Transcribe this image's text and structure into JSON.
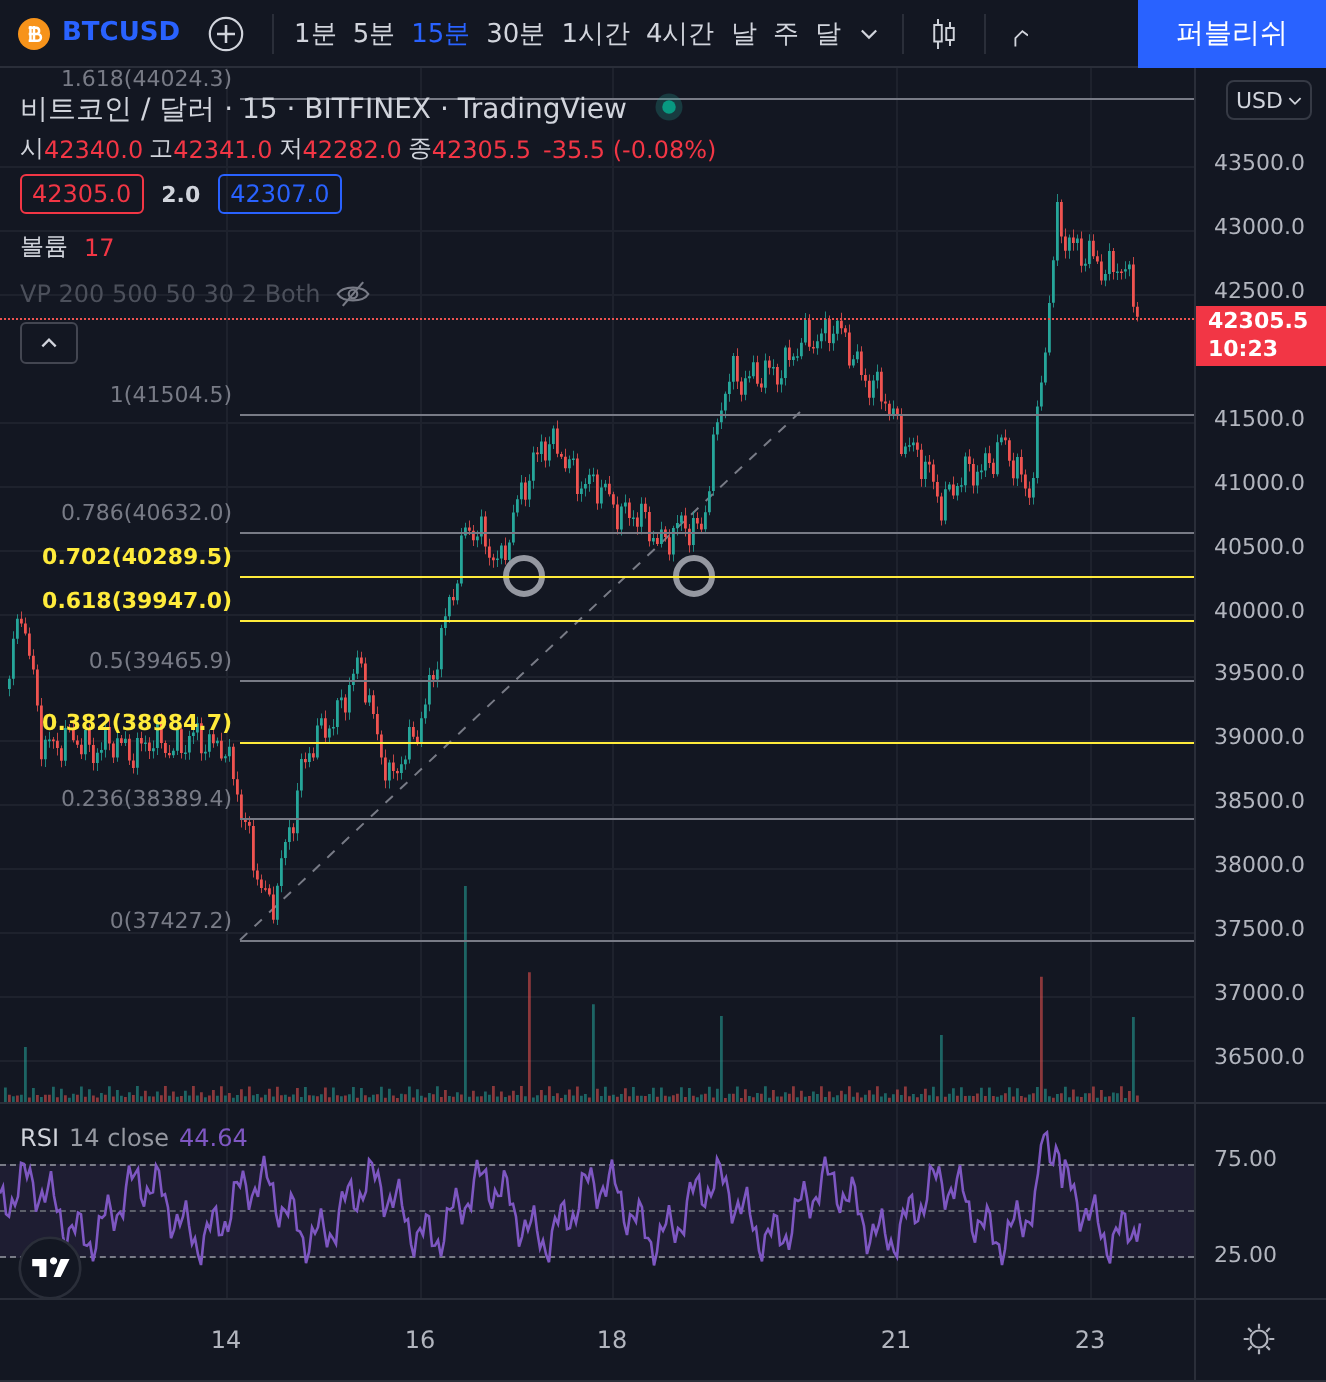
{
  "toolbar": {
    "symbol": "BTCUSD",
    "intervals": [
      {
        "label": "1분",
        "selected": false
      },
      {
        "label": "5분",
        "selected": false
      },
      {
        "label": "15분",
        "selected": true
      },
      {
        "label": "30분",
        "selected": false
      },
      {
        "label": "1시간",
        "selected": false
      },
      {
        "label": "4시간",
        "selected": false
      },
      {
        "label": "날",
        "selected": false
      },
      {
        "label": "주",
        "selected": false
      },
      {
        "label": "달",
        "selected": false
      }
    ],
    "publish_button": "퍼블리쉬"
  },
  "legend": {
    "title": "비트코인 / 달러 · 15 · BITFINEX · TradingView",
    "ohlc": [
      {
        "label": "시",
        "value": "42340.0"
      },
      {
        "label": "고",
        "value": "42341.0"
      },
      {
        "label": "저",
        "value": "42282.0"
      },
      {
        "label": "종",
        "value": "42305.5"
      }
    ],
    "change": "-35.5 (-0.08%)",
    "bid": "42305.0",
    "spread": "2.0",
    "ask": "42307.0",
    "volume": {
      "label": "볼륨",
      "value": "17"
    },
    "vp": "VP 200 500 50 30 2 Both"
  },
  "fib_levels": [
    {
      "label": "1.618(44024.3)",
      "color": "#787b86"
    },
    {
      "label": "1(41504.5)",
      "color": "#787b86"
    },
    {
      "label": "0.786(40632.0)",
      "color": "#787b86"
    },
    {
      "label": "0.702(40289.5)",
      "color": "#ffeb3b"
    },
    {
      "label": "0.618(39947.0)",
      "color": "#ffeb3b"
    },
    {
      "label": "0.5(39465.9)",
      "color": "#787b86"
    },
    {
      "label": "0.382(38984.7)",
      "color": "#ffeb3b"
    },
    {
      "label": "0.236(38389.4)",
      "color": "#787b86"
    },
    {
      "label": "0(37427.2)",
      "color": "#787b86"
    }
  ],
  "price_axis": {
    "currency": "USD",
    "ticks": [
      "43500.0",
      "43000.0",
      "42500.0",
      "41500.0",
      "41000.0",
      "40500.0",
      "40000.0",
      "39500.0",
      "39000.0",
      "38500.0",
      "38000.0",
      "37500.0",
      "37000.0",
      "36500.0"
    ],
    "last_price": "42305.5",
    "countdown": "10:23"
  },
  "rsi": {
    "name": "RSI",
    "params": "14 close",
    "value": "44.64",
    "ticks": [
      "75.00",
      "25.00"
    ]
  },
  "time_axis": [
    "14",
    "16",
    "18",
    "21",
    "23"
  ]
}
